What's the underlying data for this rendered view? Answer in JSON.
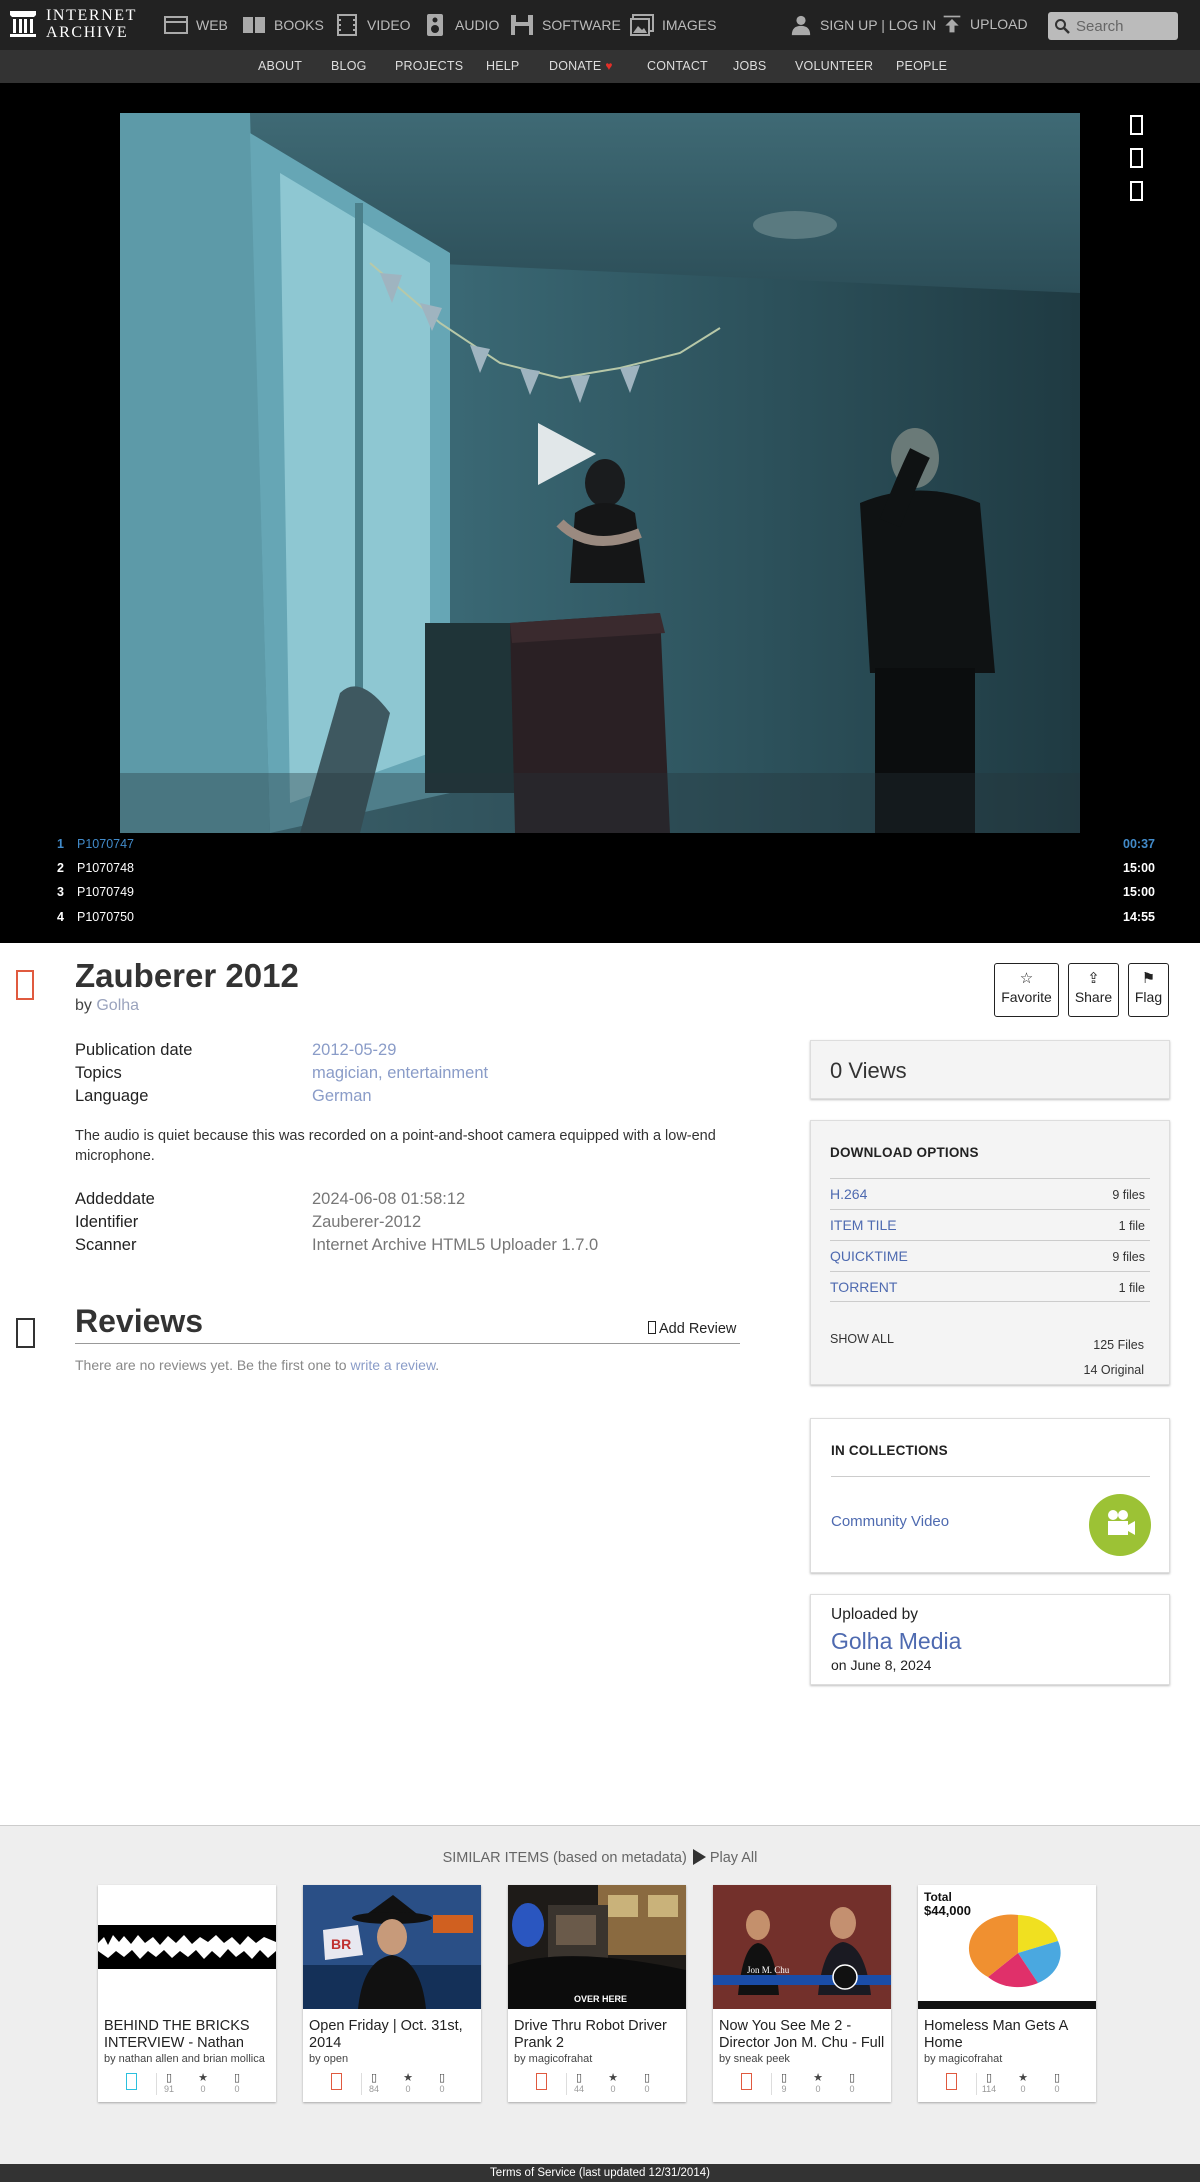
{
  "nav": {
    "logo_line1": "INTERNET",
    "logo_line2": "ARCHIVE",
    "items": [
      {
        "label": "WEB",
        "icon": "web-icon"
      },
      {
        "label": "BOOKS",
        "icon": "books-icon"
      },
      {
        "label": "VIDEO",
        "icon": "video-icon"
      },
      {
        "label": "AUDIO",
        "icon": "audio-icon"
      },
      {
        "label": "SOFTWARE",
        "icon": "software-icon"
      },
      {
        "label": "IMAGES",
        "icon": "images-icon"
      }
    ],
    "signup": "SIGN UP | LOG IN",
    "upload": "UPLOAD",
    "search_placeholder": "Search"
  },
  "subnav": [
    "ABOUT",
    "BLOG",
    "PROJECTS",
    "HELP",
    "DONATE",
    "CONTACT",
    "JOBS",
    "VOLUNTEER",
    "PEOPLE"
  ],
  "playlist": [
    {
      "num": "1",
      "name": "P1070747",
      "duration": "00:37"
    },
    {
      "num": "2",
      "name": "P1070748",
      "duration": "15:00"
    },
    {
      "num": "3",
      "name": "P1070749",
      "duration": "15:00"
    },
    {
      "num": "4",
      "name": "P1070750",
      "duration": "14:55"
    }
  ],
  "item": {
    "title": "Zauberer 2012",
    "by_prefix": "by",
    "author": "Golha",
    "actions": {
      "favorite": "Favorite",
      "share": "Share",
      "flag": "Flag"
    },
    "metadata": [
      {
        "label": "Publication date",
        "value": "2012-05-29"
      },
      {
        "label": "Topics",
        "value": "magician, entertainment"
      },
      {
        "label": "Language",
        "value": "German"
      }
    ],
    "description": "The audio is quiet because this was recorded on a point-and-shoot camera equipped with a low-end microphone.",
    "metadata2": [
      {
        "label": "Addeddate",
        "value": "2024-06-08 01:58:12"
      },
      {
        "label": "Identifier",
        "value": "Zauberer-2012"
      },
      {
        "label": "Scanner",
        "value": "Internet Archive HTML5 Uploader 1.7.0"
      }
    ]
  },
  "reviews": {
    "title": "Reviews",
    "add": "Add Review",
    "empty_prefix": "There are no reviews yet. Be the first one to",
    "empty_link": "write a review",
    "empty_suffix": "."
  },
  "sidebar": {
    "views": "0 Views",
    "download_title": "DOWNLOAD OPTIONS",
    "downloads": [
      {
        "format": "H.264",
        "count": "9 files"
      },
      {
        "format": "ITEM TILE",
        "count": "1 file"
      },
      {
        "format": "QUICKTIME",
        "count": "9 files"
      },
      {
        "format": "TORRENT",
        "count": "1 file"
      }
    ],
    "show_all": "SHOW ALL",
    "total_files": "125 Files",
    "original_files": "14 Original",
    "collections_title": "IN COLLECTIONS",
    "collection": "Community Video",
    "uploaded_by_label": "Uploaded by",
    "uploader": "Golha Media",
    "upload_date": "on June 8, 2024"
  },
  "similar": {
    "heading": "SIMILAR ITEMS (based on metadata)",
    "play_all": "Play All",
    "items": [
      {
        "title": "BEHIND THE BRICKS INTERVIEW - Nathan",
        "by": "by nathan allen and brian mollica",
        "views": "91",
        "favs": "0",
        "reviews": "0",
        "type": "audio"
      },
      {
        "title": "Open Friday | Oct. 31st, 2014",
        "by": "by open",
        "views": "84",
        "favs": "0",
        "reviews": "0",
        "type": "video"
      },
      {
        "title": "Drive Thru Robot Driver Prank 2",
        "by": "by magicofrahat",
        "views": "44",
        "favs": "0",
        "reviews": "0",
        "type": "video"
      },
      {
        "title": "Now You See Me 2 - Director Jon M. Chu - Full",
        "by": "by sneak peek",
        "views": "9",
        "favs": "0",
        "reviews": "0",
        "type": "video"
      },
      {
        "title": "Homeless Man Gets A Home",
        "by": "by magicofrahat",
        "views": "114",
        "favs": "0",
        "reviews": "0",
        "type": "video"
      }
    ]
  },
  "footer": "Terms of Service (last updated 12/31/2014)"
}
